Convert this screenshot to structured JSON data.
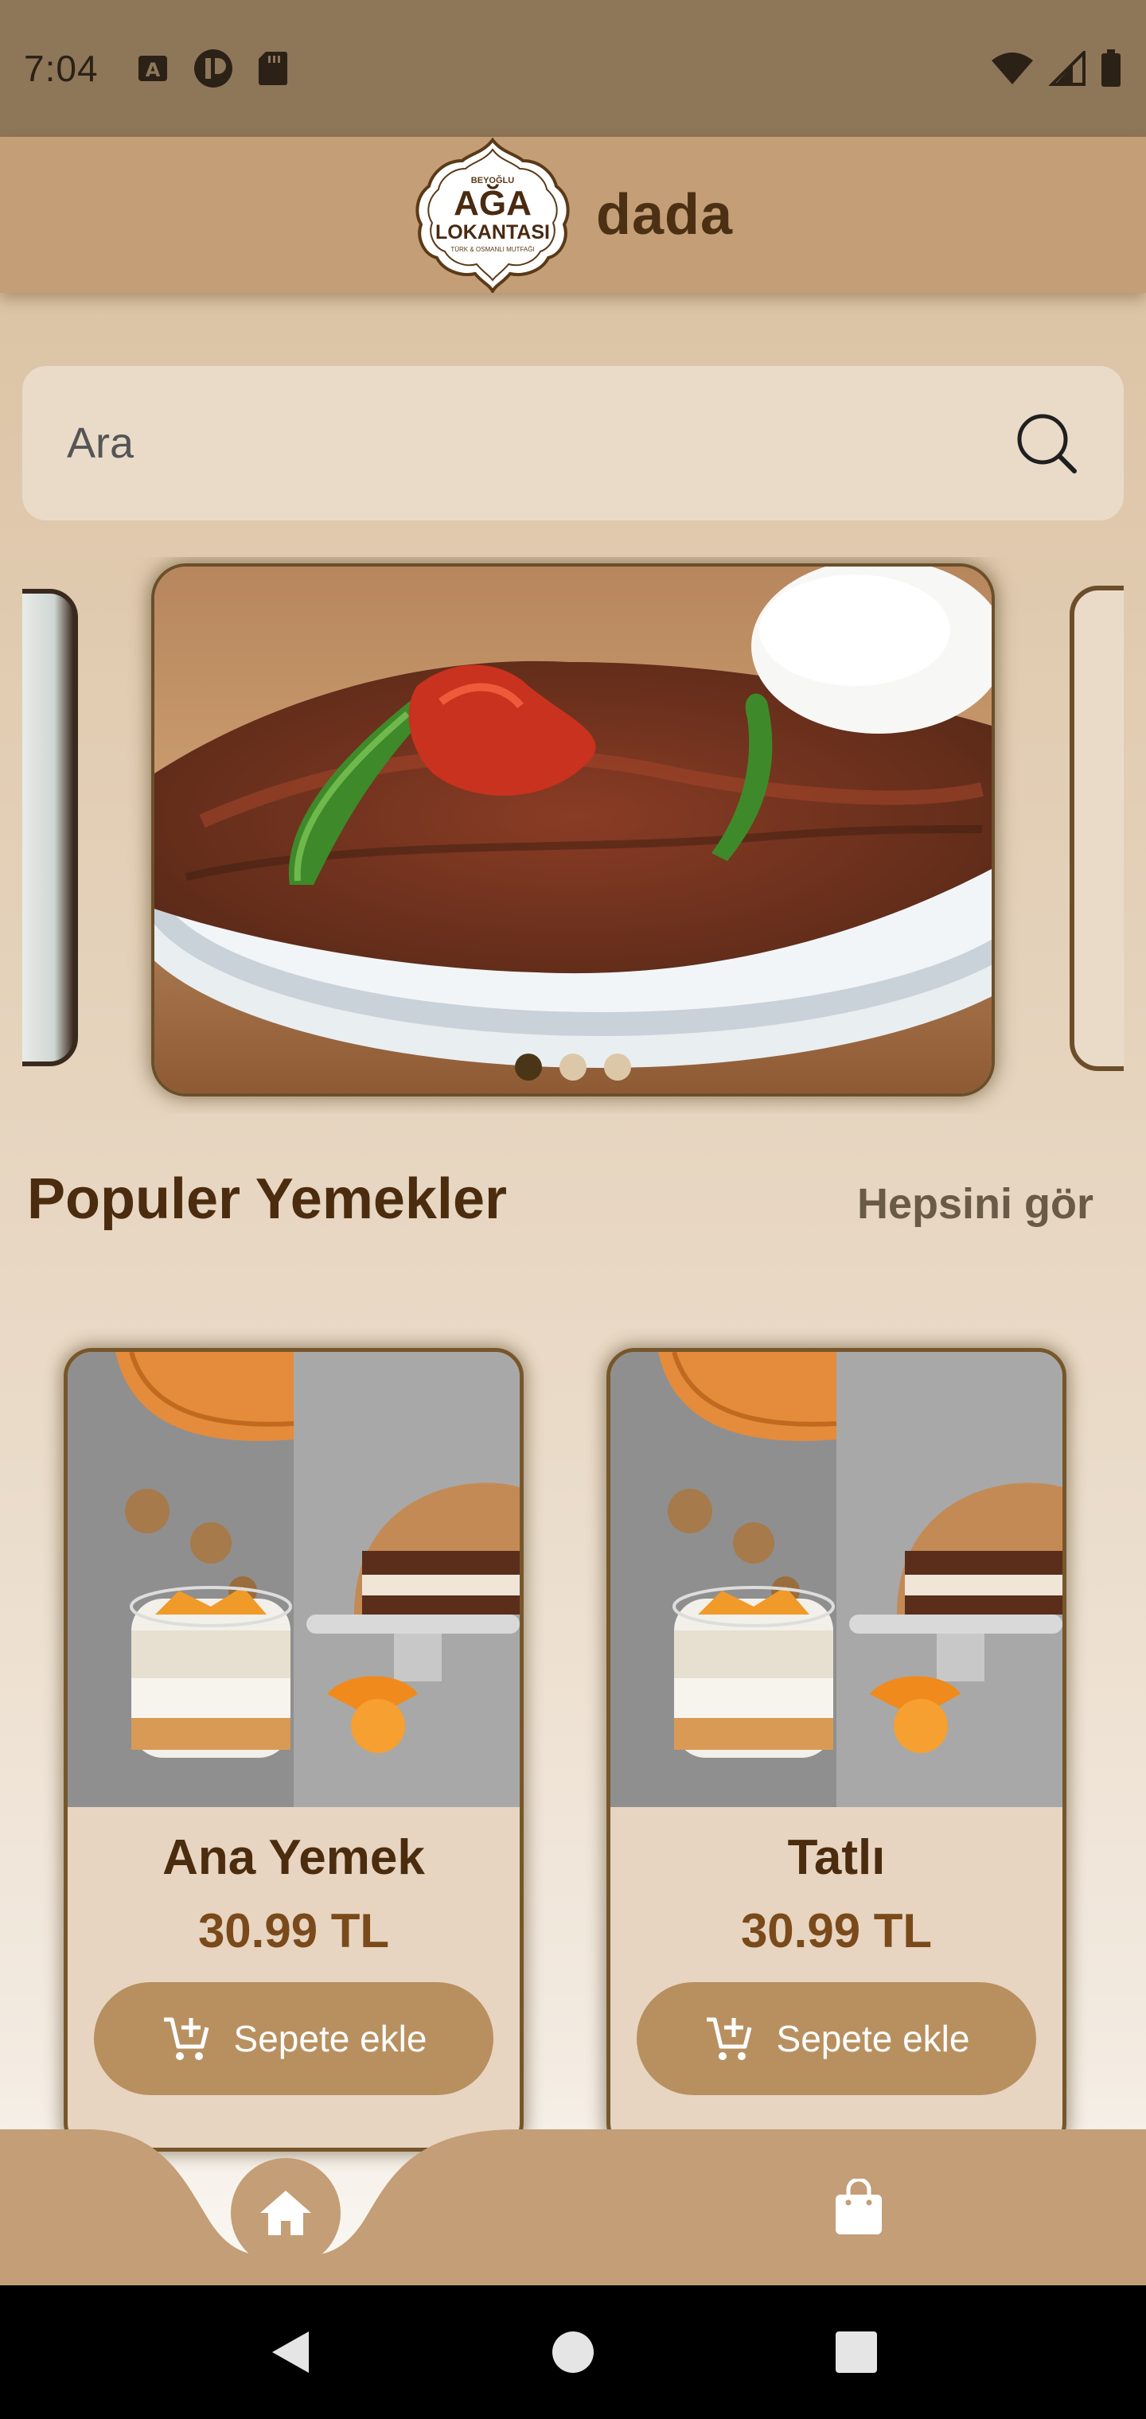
{
  "status_bar": {
    "time": "7:04",
    "left_icons": [
      "text-notification-icon",
      "vpn-icon",
      "sd-card-icon"
    ],
    "right_icons": [
      "wifi-icon",
      "cell-signal-icon",
      "battery-icon"
    ]
  },
  "app_bar": {
    "logo": {
      "top_text": "BEYOĞLU",
      "line1": "AĞA",
      "line2": "LOKANTASI",
      "tagline": "TÜRK & OSMANLI MUTFAĞI"
    },
    "title": "dada"
  },
  "search": {
    "placeholder": "Ara",
    "icon": "search-icon"
  },
  "carousel": {
    "slides": [
      "iskender-kebab-plate",
      "yogurt-dish",
      "next-slide"
    ],
    "active_index": 0,
    "dots": 3
  },
  "popular": {
    "title": "Populer Yemekler",
    "see_all": "Hepsini gör"
  },
  "products": [
    {
      "name": "Ana Yemek",
      "price": "30.99 TL",
      "button": "Sepete ekle",
      "image": "dessert-collage"
    },
    {
      "name": "Tatlı",
      "price": "30.99 TL",
      "button": "Sepete ekle",
      "image": "dessert-collage"
    }
  ],
  "bottom_nav": {
    "items": [
      "home-icon",
      "shopping-bag-icon"
    ],
    "active": "home-icon"
  },
  "system_nav": [
    "back-icon",
    "home-circle-icon",
    "recents-icon"
  ],
  "colors": {
    "app_bar": "#c39e76",
    "status_bar": "#8e7658",
    "accent_button": "#b89060",
    "title_brown": "#4b2c0e",
    "card_bg": "#e7d5c1"
  }
}
